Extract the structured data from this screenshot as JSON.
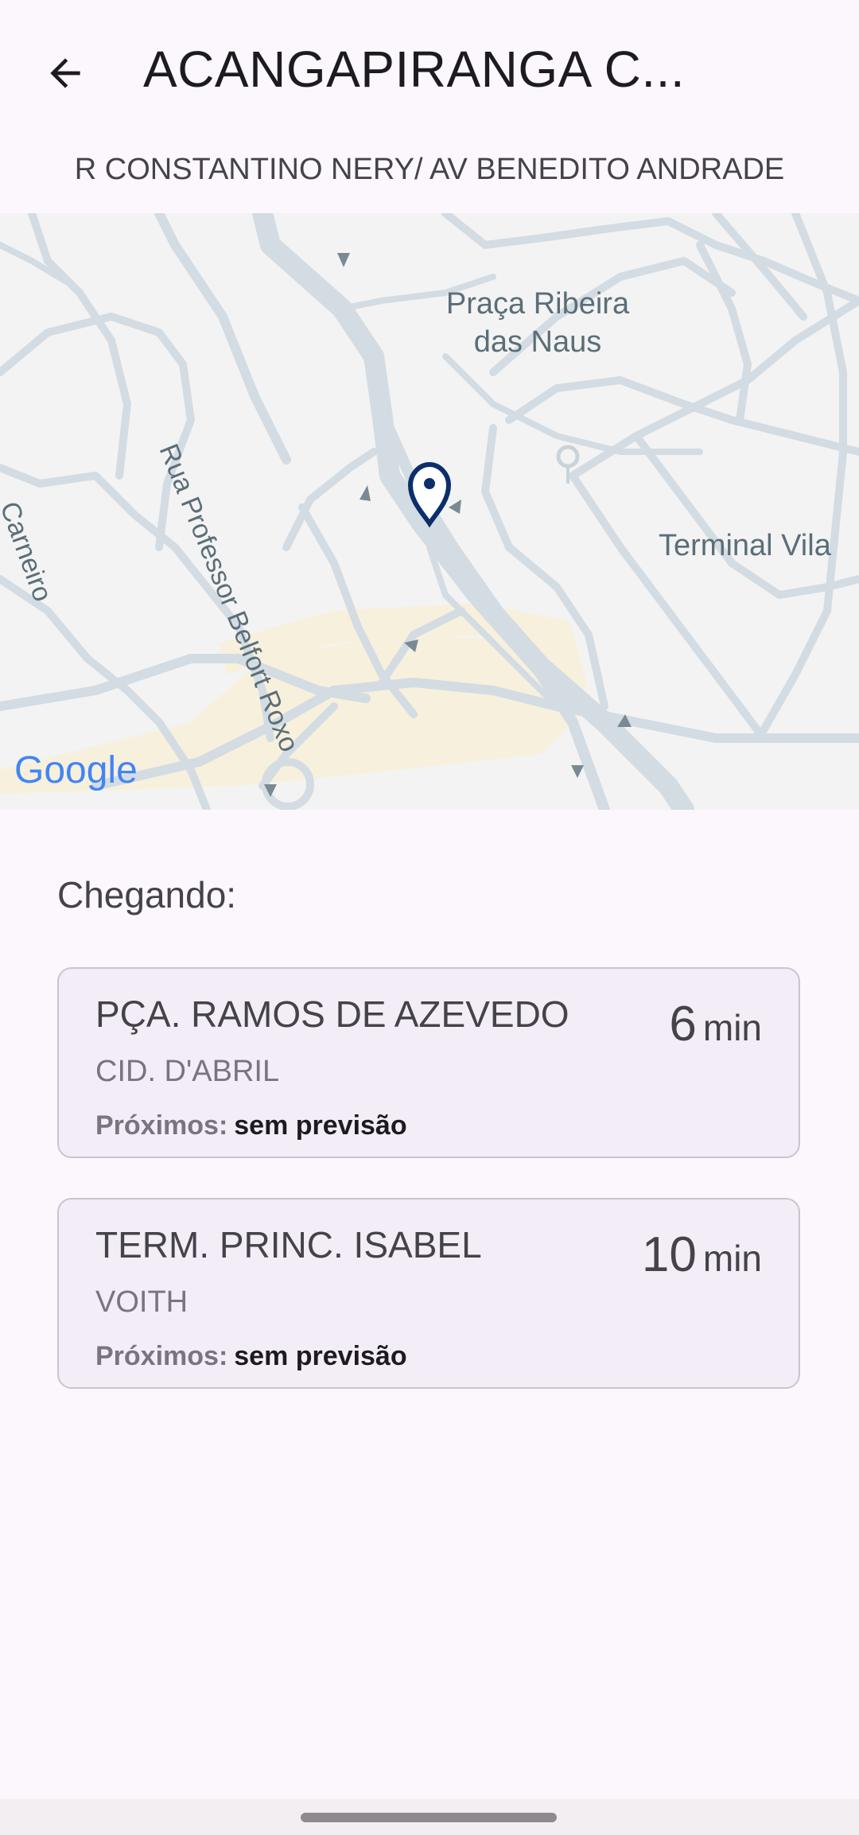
{
  "header": {
    "title": "ACANGAPIRANGA C...",
    "back_icon": "arrow-back-icon"
  },
  "stop": {
    "name": "R CONSTANTINO NERY/ AV BENEDITO ANDRADE"
  },
  "map": {
    "labels": {
      "street_1": "Rua Professor Belfort Roxo",
      "place_1_line1": "Praça Ribeira",
      "place_1_line2": "das Naus",
      "place_2": "Terminal Vila",
      "street_2": "Carneiro"
    },
    "logo": "Google",
    "pin_icon": "location-pin-icon",
    "colors": {
      "background": "#f3f3f3",
      "road": "#d3dce3",
      "area": "#f7f0dc",
      "pin": "#0b2f6b"
    }
  },
  "arrivals": {
    "label": "Chegando:",
    "items": [
      {
        "destination": "PÇA. RAMOS DE AZEVEDO",
        "origin": "CID. D'ABRIL",
        "next_label": "Próximos:",
        "next_value": "sem previsão",
        "eta": "6",
        "eta_unit": "min"
      },
      {
        "destination": "TERM. PRINC. ISABEL",
        "origin": "VOITH",
        "next_label": "Próximos:",
        "next_value": "sem previsão",
        "eta": "10",
        "eta_unit": "min"
      }
    ]
  }
}
